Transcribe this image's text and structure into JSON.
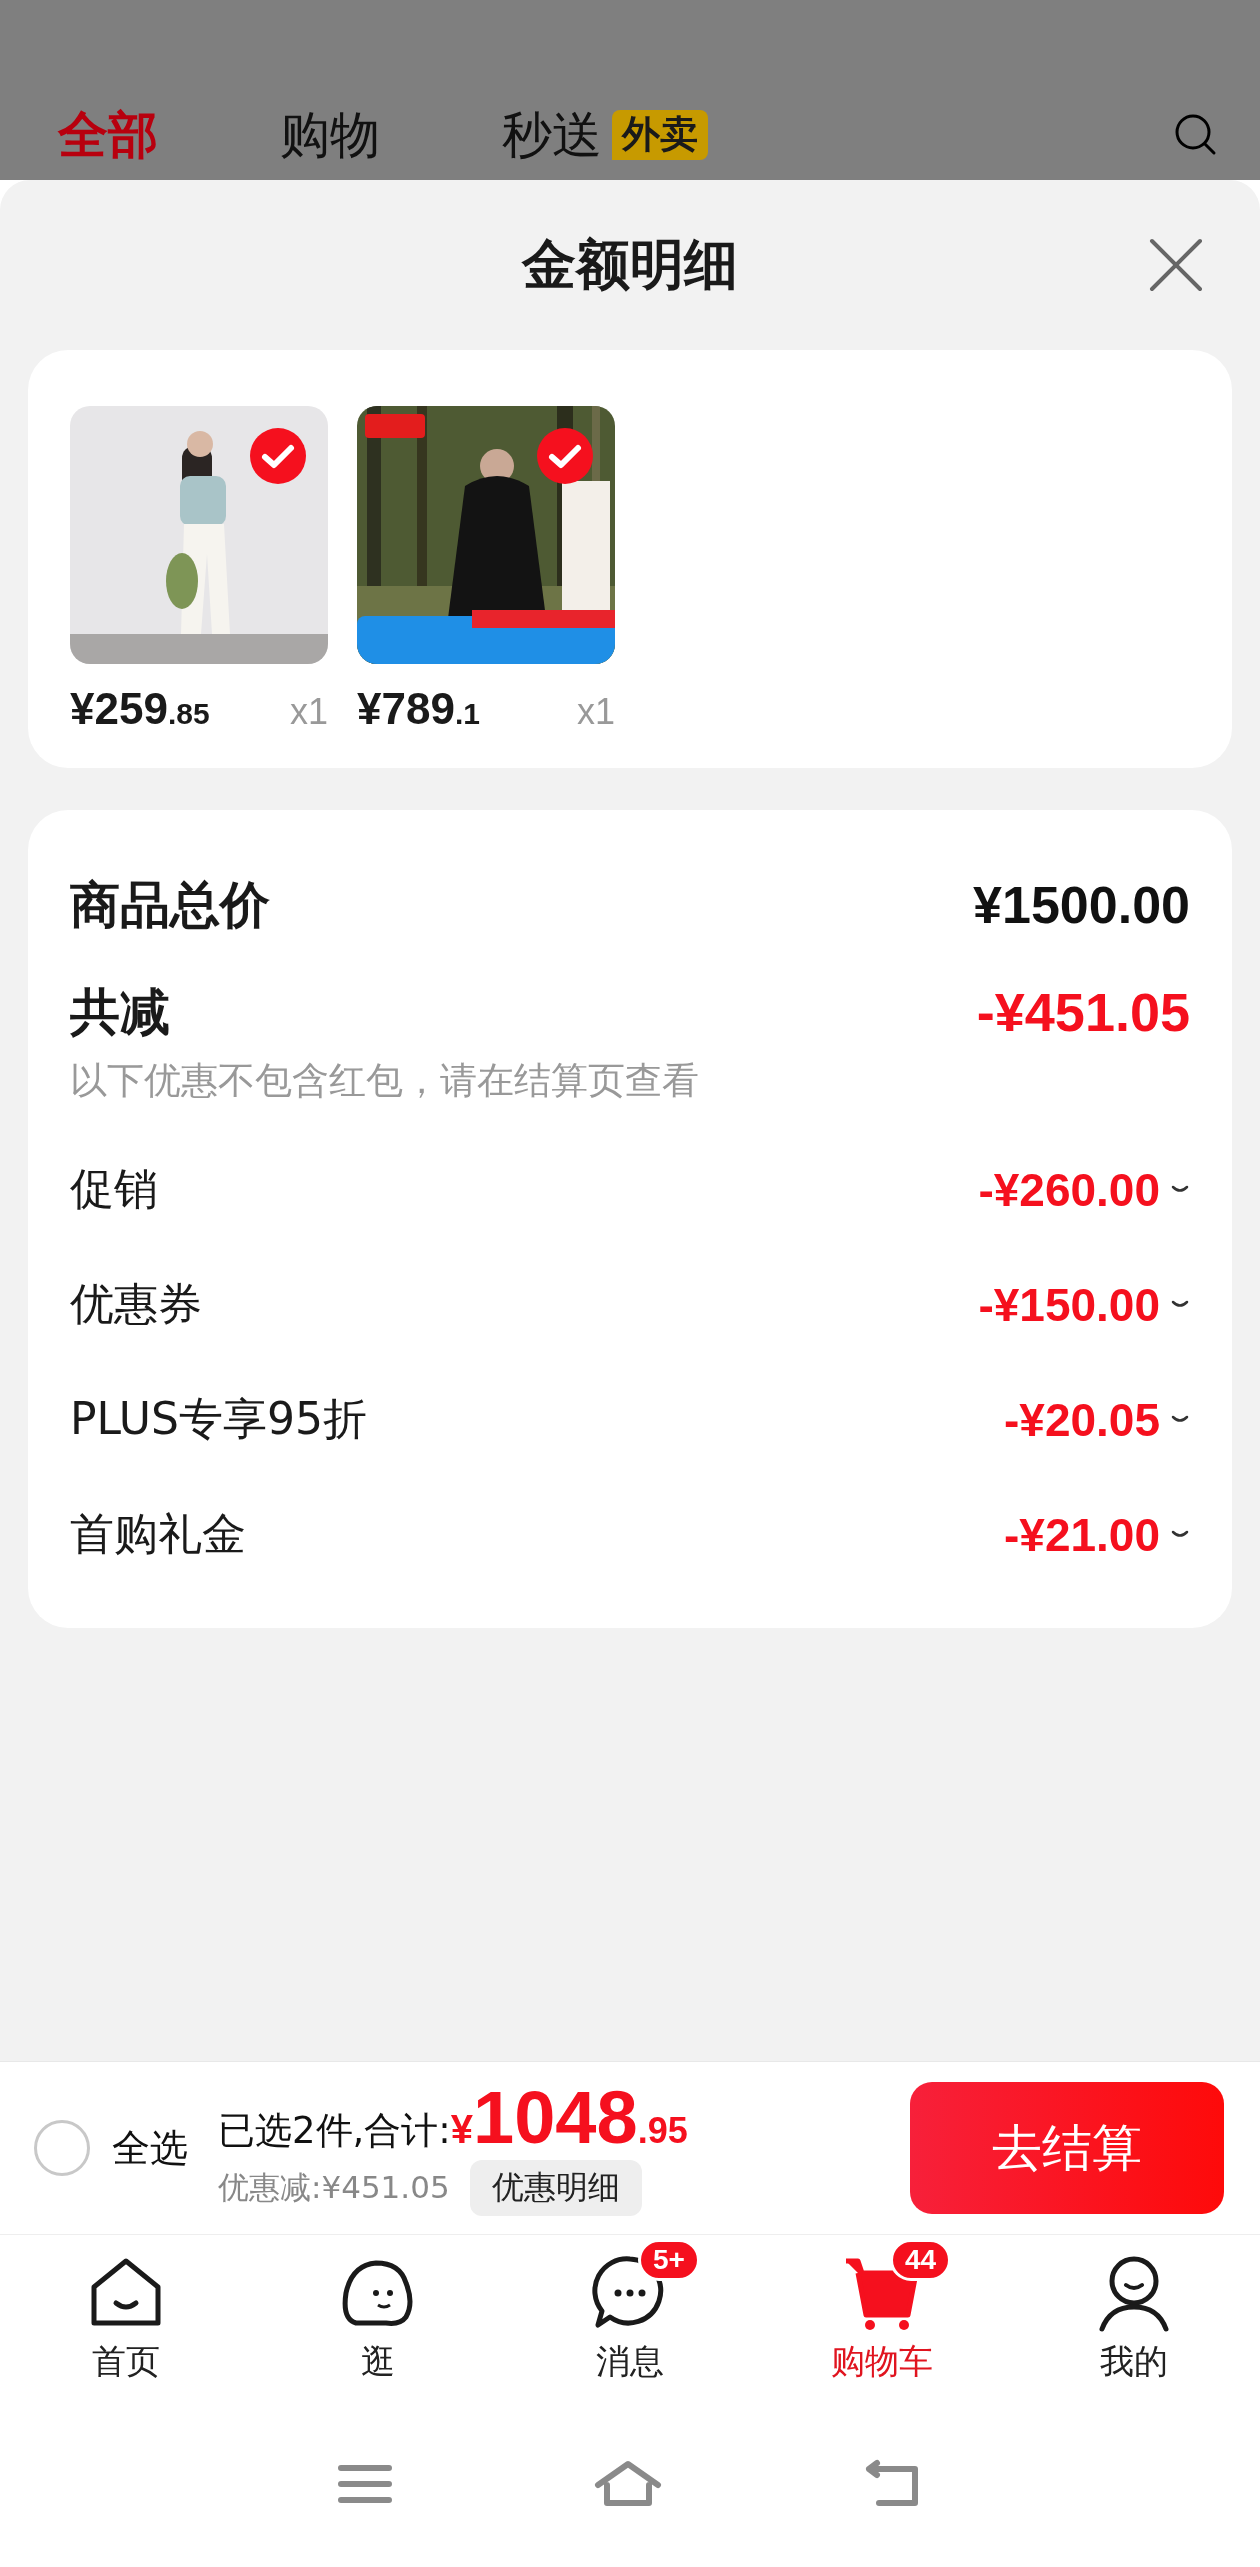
{
  "tabs": [
    {
      "label": "全部",
      "selected": true
    },
    {
      "label": "购物",
      "selected": false
    },
    {
      "label": "秒送",
      "selected": false,
      "badge": "外卖"
    }
  ],
  "sheet": {
    "title": "金额明细",
    "products": [
      {
        "kind": "picture",
        "price_main": "¥259",
        "price_decimal": ".85",
        "quantity": "x1",
        "selected": true
      },
      {
        "kind": "picture",
        "price_main": "¥789",
        "price_decimal": ".1",
        "quantity": "x1",
        "selected": true
      }
    ],
    "total": {
      "label": "商品总价",
      "value": "¥1500.00"
    },
    "reduction": {
      "label": "共减",
      "value": "-¥451.05",
      "note": "以下优惠不包含红包，请在结算页查看"
    },
    "discounts": [
      {
        "label": "促销",
        "value": "-¥260.00",
        "expanded": false
      },
      {
        "label": "优惠券",
        "value": "-¥150.00",
        "expanded": false
      },
      {
        "label": "PLUS专享95折",
        "value": "-¥20.05",
        "expanded": false
      },
      {
        "label": "首购礼金",
        "value": "-¥21.00",
        "expanded": false
      }
    ]
  },
  "checkout_bar": {
    "select_all": {
      "label": "全选",
      "checked": false
    },
    "summary": "已选2件,合计:",
    "currency": "¥",
    "total_main": "1048",
    "total_decimal": ".95",
    "savings": "优惠减:¥451.05",
    "detail_button": "优惠明细",
    "checkout_button": "去结算"
  },
  "bottom_nav": [
    {
      "kind": "home",
      "label": "首页",
      "selected": false
    },
    {
      "kind": "browse",
      "label": "逛",
      "selected": false
    },
    {
      "kind": "message",
      "label": "消息",
      "selected": false,
      "badge": "5+"
    },
    {
      "kind": "cart",
      "label": "购物车",
      "selected": true,
      "badge": "44"
    },
    {
      "kind": "profile",
      "label": "我的",
      "selected": false
    }
  ]
}
